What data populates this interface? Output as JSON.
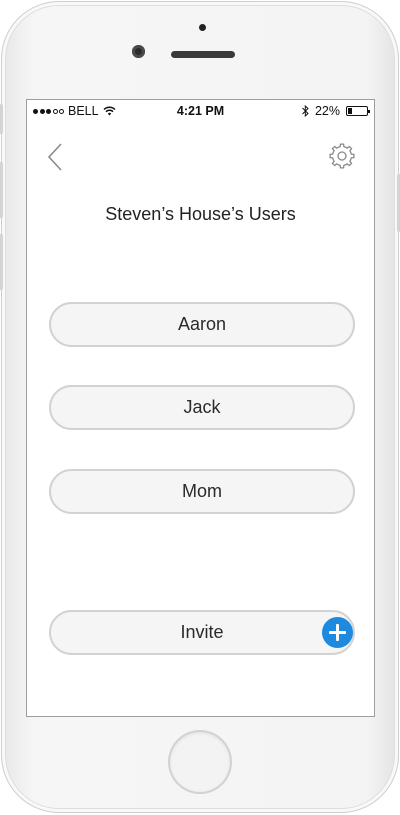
{
  "status_bar": {
    "carrier": "BELL",
    "time": "4:21 PM",
    "battery_percent": "22%",
    "battery_level": 0.22,
    "signal_bars_filled": 3,
    "signal_bars_total": 5,
    "icons": [
      "wifi-icon",
      "bluetooth-icon",
      "battery-icon"
    ]
  },
  "nav": {
    "back_icon": "chevron-left-icon",
    "settings_icon": "gear-icon"
  },
  "title": "Steven’s House’s Users",
  "users": [
    "Aaron",
    "Jack",
    "Mom"
  ],
  "invite": {
    "label": "Invite",
    "icon": "plus-circle-icon"
  },
  "colors": {
    "accent": "#1d8ae0",
    "pill_bg": "#f5f5f5",
    "pill_border": "#d2d2d2",
    "nav_icon": "#8a8a8a"
  }
}
